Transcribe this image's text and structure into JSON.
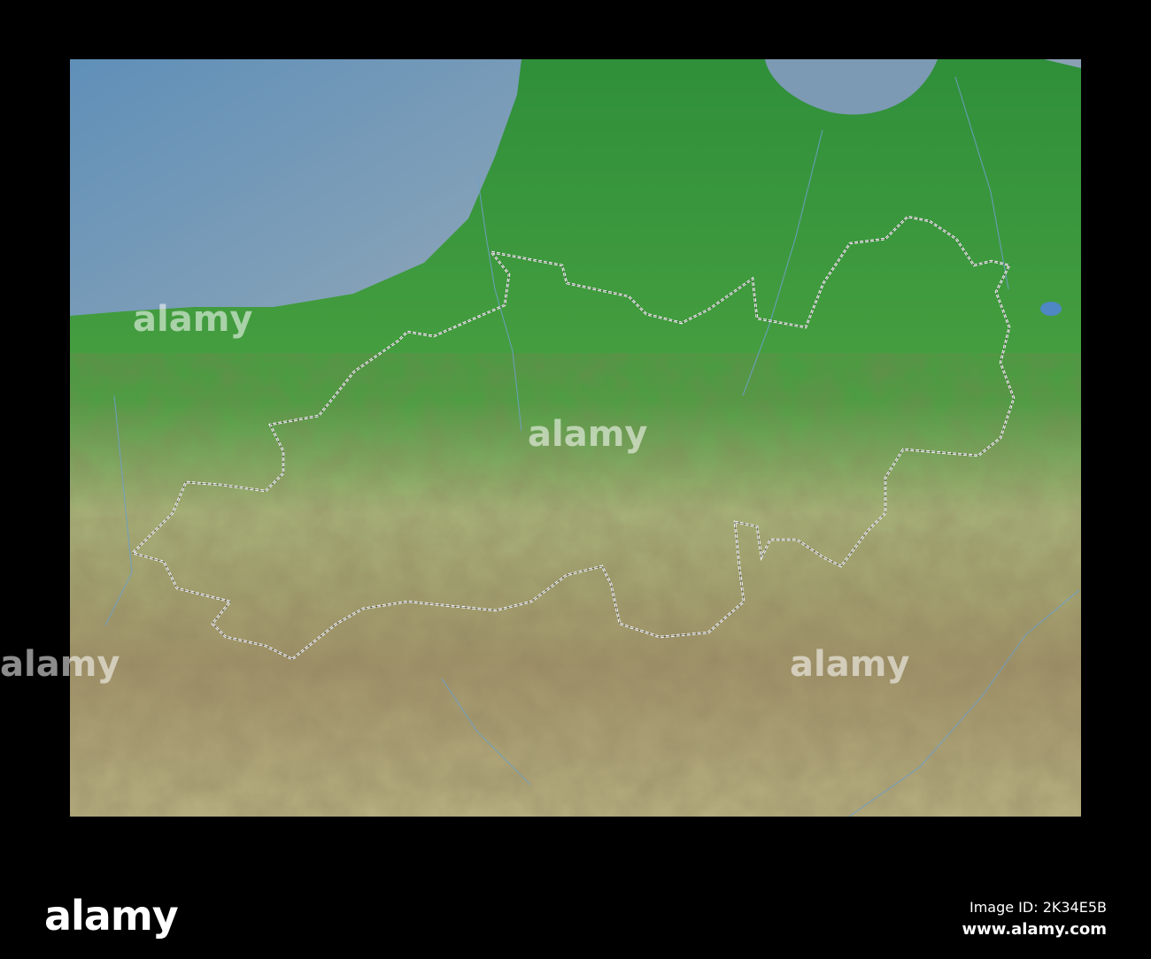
{
  "map": {
    "colors": {
      "sea": "#6b93b5",
      "lowland": "#3f9a3c",
      "hills": "#9fb06a",
      "mountains": "#a08a62",
      "border": "#ffffff"
    },
    "region_border_style": "dashed-white"
  },
  "watermark": {
    "text": "alamy"
  },
  "footer": {
    "logo": "alamy",
    "image_id": "Image ID: 2K34E5B",
    "website": "www.alamy.com"
  }
}
